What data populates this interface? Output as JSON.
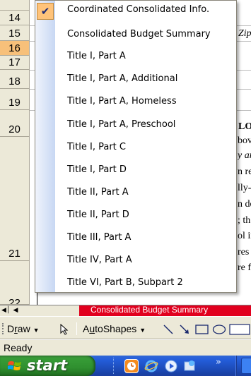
{
  "sheet": {
    "rows": [
      {
        "number": "14",
        "selected": false
      },
      {
        "number": "15",
        "selected": false
      },
      {
        "number": "16",
        "selected": true
      },
      {
        "number": "17",
        "selected": false
      },
      {
        "number": "18",
        "selected": false
      },
      {
        "number": "19",
        "selected": false
      },
      {
        "number": "20",
        "selected": false
      },
      {
        "number": "21",
        "selected": false
      },
      {
        "number": "22",
        "selected": false
      }
    ],
    "cells": {
      "row15_right": "Zip",
      "row20_right": "LO",
      "body_lines": [
        "bov",
        "y ar",
        "n re",
        "lly-",
        "n de",
        "; th",
        "ol in",
        "res",
        "re f"
      ]
    },
    "active_tab": "Consolidated Budget Summary"
  },
  "popup_menu": {
    "items": [
      {
        "label": "Coordinated Consolidated Info.",
        "checked": true
      },
      {
        "label": "Consolidated Budget Summary",
        "checked": false
      },
      {
        "label": "Title I, Part A",
        "checked": false
      },
      {
        "label": "Title I, Part A, Additional",
        "checked": false
      },
      {
        "label": "Title I, Part A, Homeless",
        "checked": false
      },
      {
        "label": "Title I, Part A, Preschool",
        "checked": false
      },
      {
        "label": "Title I, Part C",
        "checked": false
      },
      {
        "label": "Title I, Part D",
        "checked": false
      },
      {
        "label": "Title II, Part A",
        "checked": false
      },
      {
        "label": "Title II, Part D",
        "checked": false
      },
      {
        "label": "Title III, Part A",
        "checked": false
      },
      {
        "label": "Title IV, Part A",
        "checked": false
      },
      {
        "label": "Title VI, Part B, Subpart 2",
        "checked": false
      }
    ]
  },
  "drawing_toolbar": {
    "draw_label_prefix": "D",
    "draw_label_ul": "r",
    "draw_label_suffix": "aw",
    "autoshapes_prefix": "A",
    "autoshapes_ul": "u",
    "autoshapes_suffix": "toShapes"
  },
  "status_bar": {
    "text": "Ready"
  },
  "taskbar": {
    "start_label": "start"
  },
  "colors": {
    "selected_row": "#f7c07a",
    "tab_red": "#e1001e",
    "menu_check": "#ffc37a",
    "taskbar_blue": "#245edb",
    "start_green": "#379c37"
  }
}
